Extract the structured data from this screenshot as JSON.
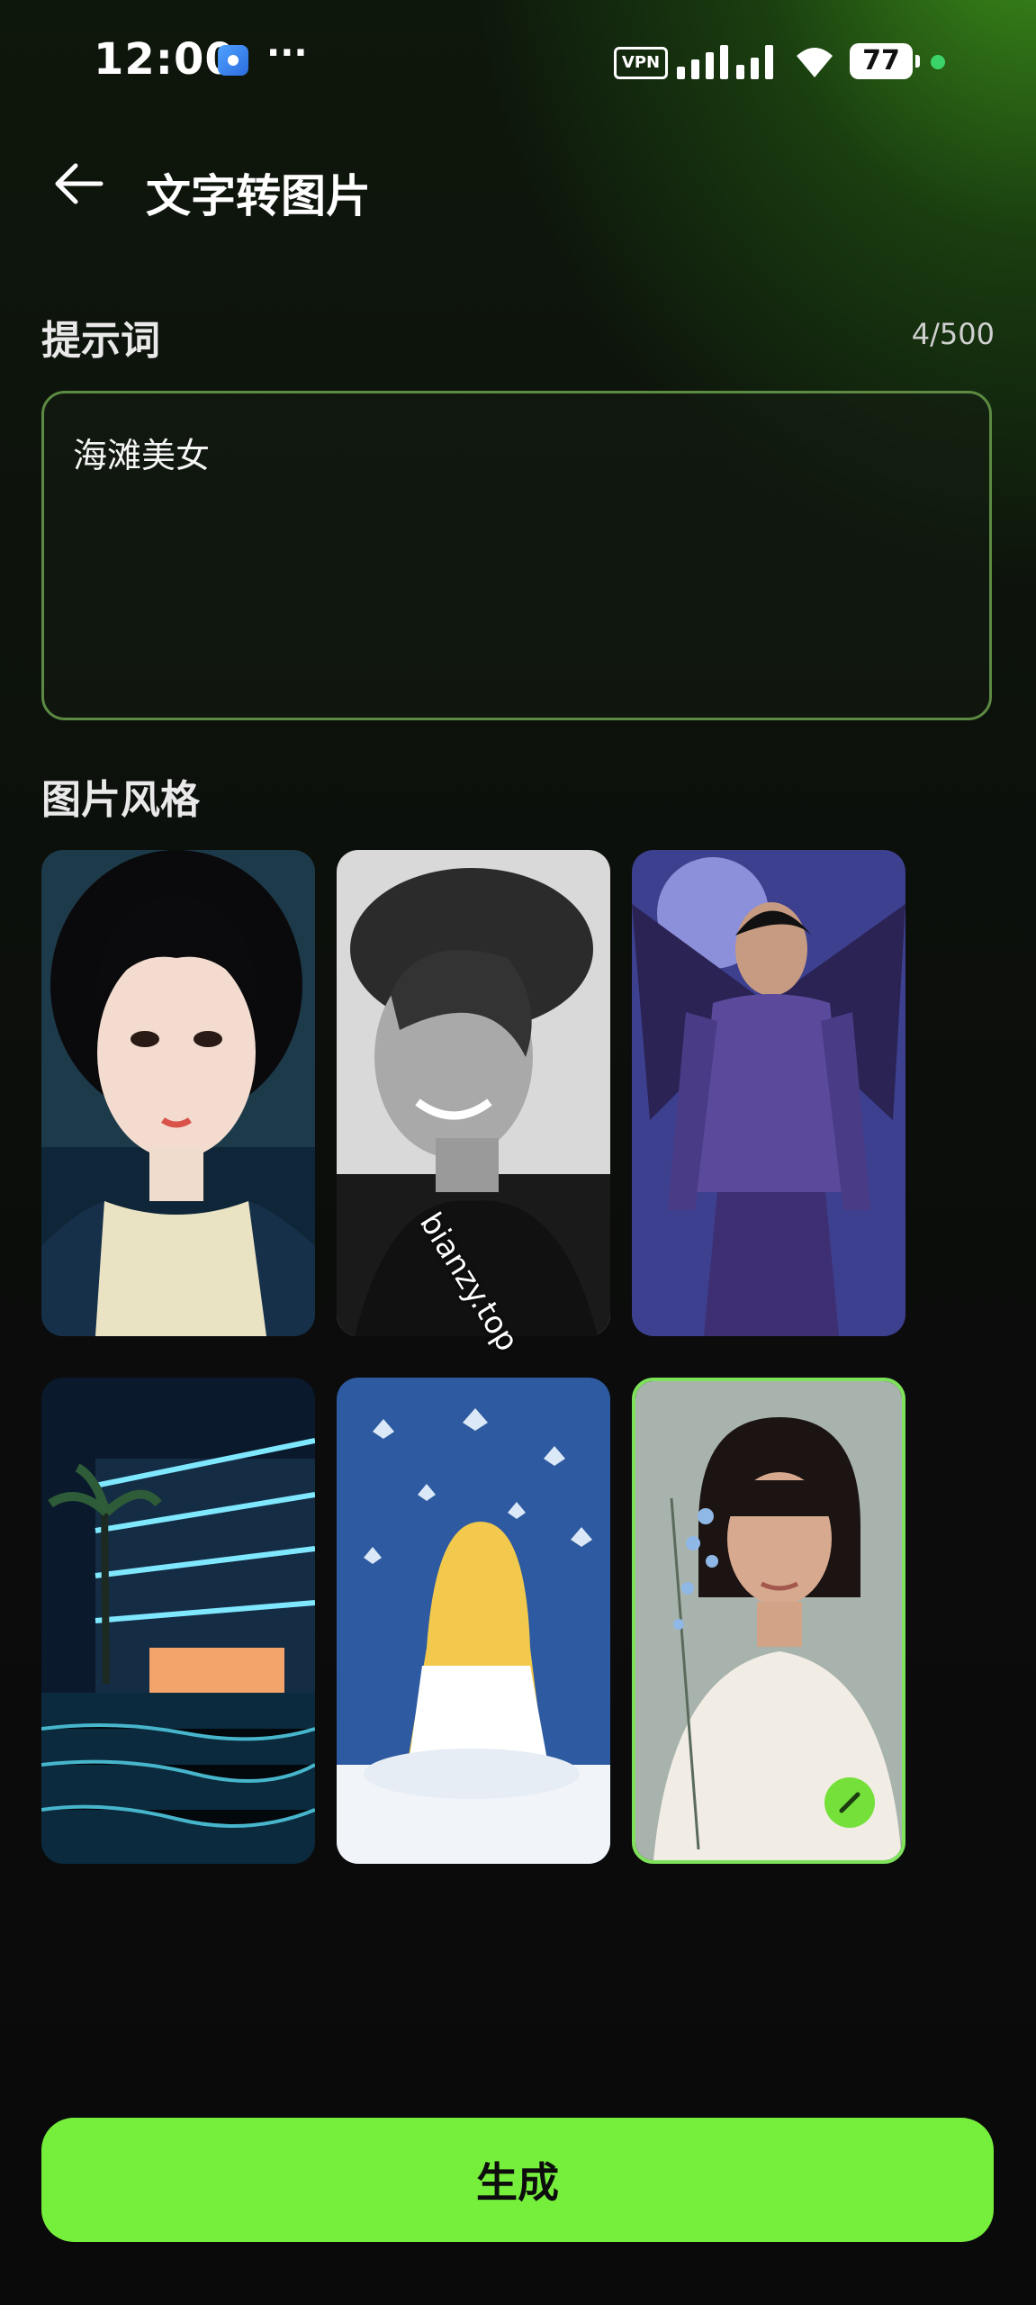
{
  "status": {
    "time": "12:00",
    "more": "···",
    "vpn": "VPN",
    "battery": "77"
  },
  "header": {
    "title": "文字转图片"
  },
  "prompt": {
    "label": "提示词",
    "counter": "4/500",
    "value": "海滩美女"
  },
  "style": {
    "label": "图片风格",
    "cards": [
      {
        "name": "style-card-anime-portrait",
        "selected": false
      },
      {
        "name": "style-card-bw-photo",
        "selected": false
      },
      {
        "name": "style-card-fantasy-demon",
        "selected": false
      },
      {
        "name": "style-card-neon-city",
        "selected": false
      },
      {
        "name": "style-card-watercolor",
        "selected": false
      },
      {
        "name": "style-card-realistic-portrait",
        "selected": true
      }
    ],
    "watermark": "bianzy.top"
  },
  "actions": {
    "generate": "生成"
  },
  "colors": {
    "accent": "#76ee3c",
    "border": "#5c8a42"
  }
}
